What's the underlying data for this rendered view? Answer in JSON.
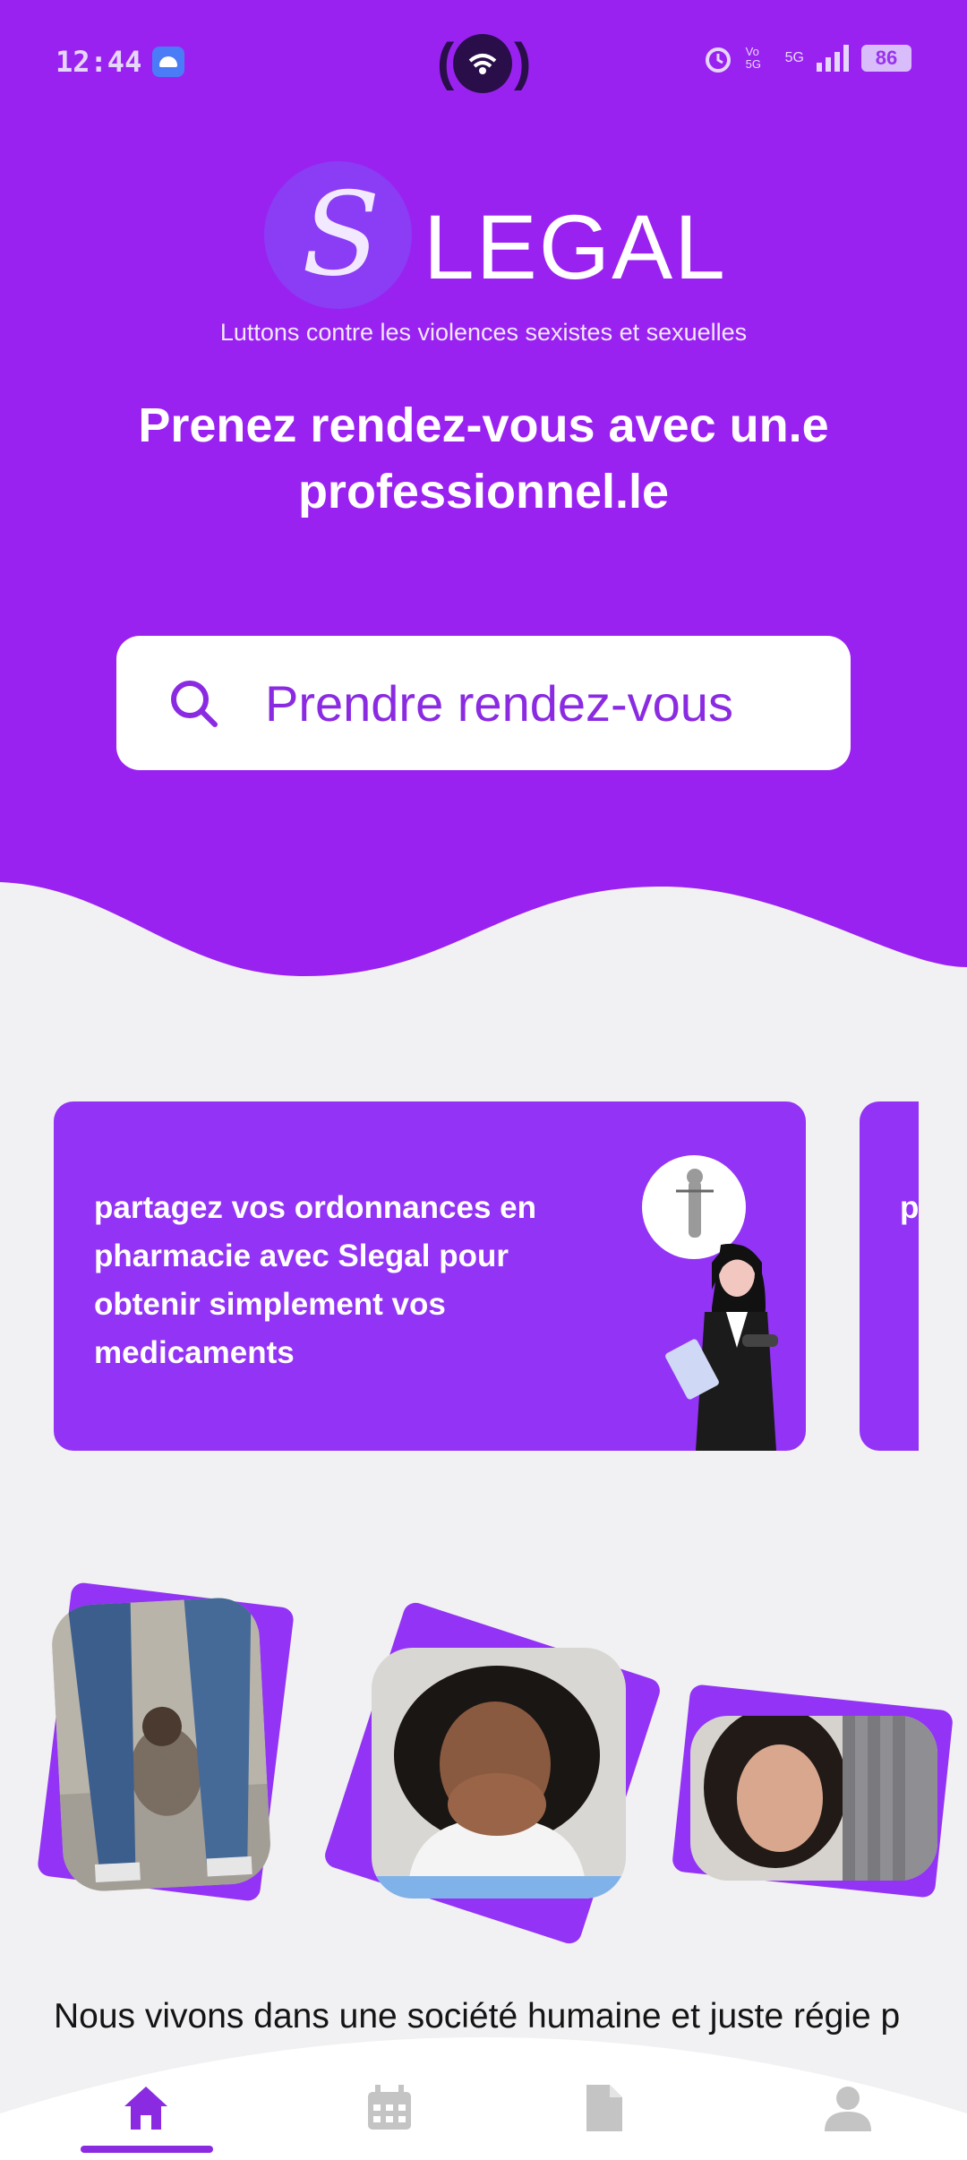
{
  "status_bar": {
    "time": "12:44",
    "network": "5G",
    "volte": "Vo 5G",
    "battery": "86"
  },
  "header": {
    "logo_letter": "S",
    "logo_word": "LEGAL",
    "tagline": "Luttons contre les violences sexistes et sexuelles",
    "headline": "Prenez rendez-vous avec un.e professionnel.le",
    "search_label": "Prendre rendez-vous"
  },
  "carousel": [
    {
      "text": "partagez vos ordonnances en pharmacie avec Slegal pour obtenir simplement vos medicaments"
    },
    {
      "text": "p e p m"
    }
  ],
  "intro": {
    "text": "Nous vivons dans une société humaine et juste régie p"
  },
  "colors": {
    "brand": "#9a22f0",
    "card": "#9333f5",
    "accent": "#8a2be2",
    "nav_inactive": "#c4c4c4"
  },
  "nav": {
    "items": [
      "home-icon",
      "calendar-icon",
      "document-icon",
      "profile-icon"
    ],
    "active": "home-icon"
  }
}
